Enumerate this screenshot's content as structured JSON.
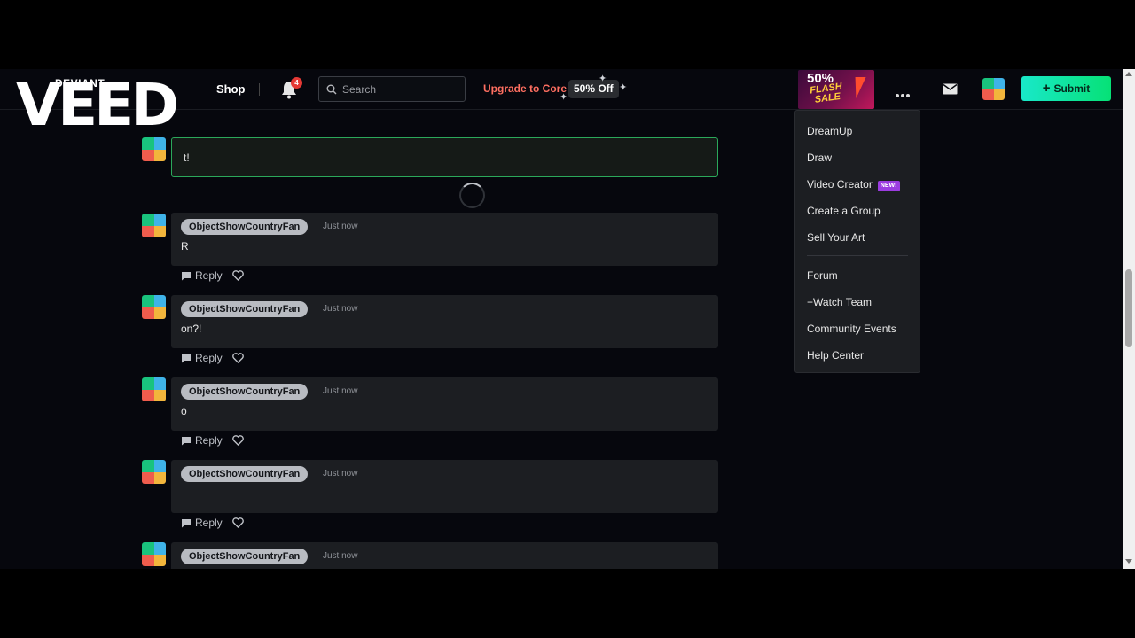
{
  "header": {
    "logo_text": "DEVIANT",
    "shop_label": "Shop",
    "notification_count": "4",
    "search_placeholder": "Search",
    "upgrade_label": "Upgrade to Core",
    "discount_label": "50% Off",
    "flash_sale": {
      "percent": "50%",
      "line1": "FLASH",
      "line2": "SALE"
    },
    "submit_label": "Submit"
  },
  "watermark": "VEED",
  "compose": {
    "value": "t!"
  },
  "comments": [
    {
      "username": "ObjectShowCountryFan",
      "time": "Just now",
      "text": "R",
      "reply_label": "Reply"
    },
    {
      "username": "ObjectShowCountryFan",
      "time": "Just now",
      "text": "on?!",
      "reply_label": "Reply"
    },
    {
      "username": "ObjectShowCountryFan",
      "time": "Just now",
      "text": "o",
      "reply_label": "Reply"
    },
    {
      "username": "ObjectShowCountryFan",
      "time": "Just now",
      "text": "",
      "reply_label": "Reply"
    },
    {
      "username": "ObjectShowCountryFan",
      "time": "Just now",
      "text": ""
    }
  ],
  "menu": {
    "items": [
      "DreamUp",
      "Draw",
      "Video Creator",
      "Create a Group",
      "Sell Your Art",
      "Forum",
      "+Watch Team",
      "Community Events",
      "Help Center"
    ],
    "new_badge": "NEW!"
  },
  "colors": {
    "background": "#06070d",
    "accent_green": "#06e176",
    "upgrade_red": "#ff6f61",
    "badge_purple": "#9b3ce0"
  }
}
